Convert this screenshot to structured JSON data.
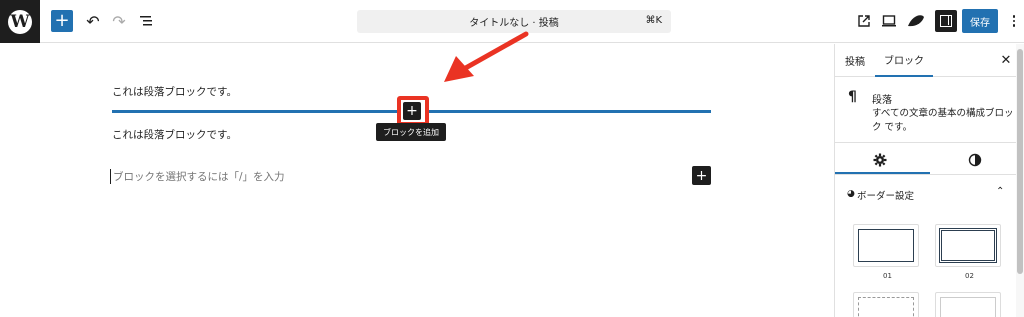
{
  "toolbar": {
    "logo_letter": "W",
    "add_symbol": "+",
    "undo_symbol": "↶",
    "redo_symbol": "↷",
    "list_view_icon": "list-view-icon",
    "document_title": "タイトルなし · 投稿",
    "shortcut": "⌘K",
    "preview_icon": "external-link-icon",
    "device_icon": "desktop-icon",
    "styles_icon": "styles-icon",
    "save_label": "保存"
  },
  "editor": {
    "paragraph_1": "これは段落ブロックです。",
    "paragraph_2": "これは段落ブロックです。",
    "inserter_symbol": "+",
    "inserter_tooltip": "ブロックを追加",
    "placeholder": "ブロックを選択するには「/」を入力",
    "append_symbol": "+",
    "divider_color": "#2271b1",
    "annotation_color": "#ea3323"
  },
  "sidebar": {
    "tabs": [
      "投稿",
      "ブロック"
    ],
    "active_tab": "ブロック",
    "close_symbol": "✕",
    "block_icon": "¶",
    "block_name": "段落",
    "block_description": "すべての文章の基本の構成ブロック です。",
    "settings_tab_icon": "gear-icon",
    "styles_tab_icon": "contrast-icon",
    "panel_title": "ボーダー設定",
    "panel_icon": "border-icon",
    "panel_expanded": true,
    "style_options": [
      {
        "label": "01"
      },
      {
        "label": "02"
      }
    ]
  },
  "colors": {
    "accent": "#2271b1",
    "dark": "#1e1e1e",
    "annotation_red": "#ea3323"
  }
}
